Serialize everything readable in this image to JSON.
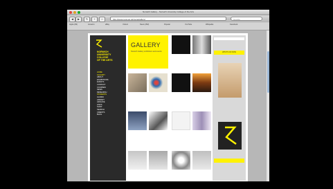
{
  "window": {
    "title": "Norwich Gallery - Norwich University College of the Arts"
  },
  "toolbar": {
    "back": "◀",
    "forward": "▶",
    "reload": "↻",
    "url": "http://www.nuca.ac.uk/nuca/gallery/",
    "search_placeholder": "Google"
  },
  "bookmarks": [
    "Apple (83)",
    "Amazon",
    "eBay",
    "Yahoo!",
    "News (352)",
    "Popular",
    "YouTube",
    "Wikipedia",
    "Facebook"
  ],
  "site": {
    "college_name": "NORWICH\nUNIVERSITY\nCOLLEGE\nOF THE ARTS",
    "nav": [
      "HOME",
      "GALLERY",
      "ABOUT",
      "EXHIBITIONS",
      "EVENTS",
      "CONTACT",
      "COURSES",
      "NEWS",
      "RESEARCH",
      "STUDENTS",
      "ALUMNI",
      "LIBRARY",
      "ARCHIVE",
      "LINKS",
      "SHOP",
      "SEARCH",
      "CREDITS",
      "BLOG"
    ],
    "gallery_title": "GALLERY",
    "gallery_subtitle": "Norwich Gallery exhibitions and events"
  },
  "sidebar_right": {
    "button_label": "WHAT'S ON NOW"
  },
  "colors": {
    "accent": "#fff200",
    "dark_panel": "#2a2a2a"
  }
}
